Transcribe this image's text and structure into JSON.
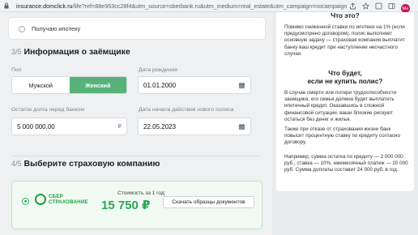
{
  "browser": {
    "url_host": "insurance.domclick.ru",
    "url_path": "/life?ref=88e953cc28f4&utm_source=sberbank.ru&utm_medium=real_estate&utm_campaign=nocampaign",
    "avatar_letters": "Me"
  },
  "mortgage_option": {
    "label": "Получаю ипотеку"
  },
  "borrower_section": {
    "step": "3/5",
    "title": "Информация о заёмщике",
    "gender": {
      "label": "Пол",
      "options": [
        "Мужской",
        "Женский"
      ],
      "selected": "Женский"
    },
    "birth_date": {
      "label": "Дата рождения",
      "value": "01.01.2000"
    },
    "debt_balance": {
      "label": "Остаток долга перед банком",
      "value": "5 000 000.00",
      "currency": "₽"
    },
    "policy_start": {
      "label": "Дата начала действия нового полиса",
      "value": "22.05.2023"
    }
  },
  "company_section": {
    "step": "4/5",
    "title": "Выберите страховую компанию",
    "offer": {
      "logo_line1": "СБЕР",
      "logo_line2": "СТРАХОВАНИЕ",
      "cost_label": "Стоимость за 1 год:",
      "cost_value": "15 750 ₽",
      "download_button": "Скачать образцы документов"
    }
  },
  "info_panel": {
    "heading1": "Что это?",
    "text1": "Помимо сниженной ставки по ипотеке на 1% (если предусмотрено договором), полис выполняет основную задачу — страховая компания выплатит банку ваш кредит при наступлении несчастного случая.",
    "heading2_line1": "Что будет,",
    "heading2_line2": "если не купить полис?",
    "text2": "В случае смерти или потери трудоспособности заемщика, его семья должна будет выплатить ипотечный кредит. Оказавшись в сложной финансовой ситуации, ваши близкие рискуют остаться без денег и жилья.",
    "text3": "Также при отказе от страхования жизни банк повысит процентную ставку по кредиту согласно договору.",
    "text4": "Например, сумма остатка по кредиту — 2 000 000 руб., ставка — 10%, ежемесячный платеж — 20 000 руб. Сумма доплаты составит 24 000 руб. в год."
  },
  "colors": {
    "accent_green": "#57b27a",
    "price_green": "#2fa455",
    "sber_green": "#21a038"
  }
}
